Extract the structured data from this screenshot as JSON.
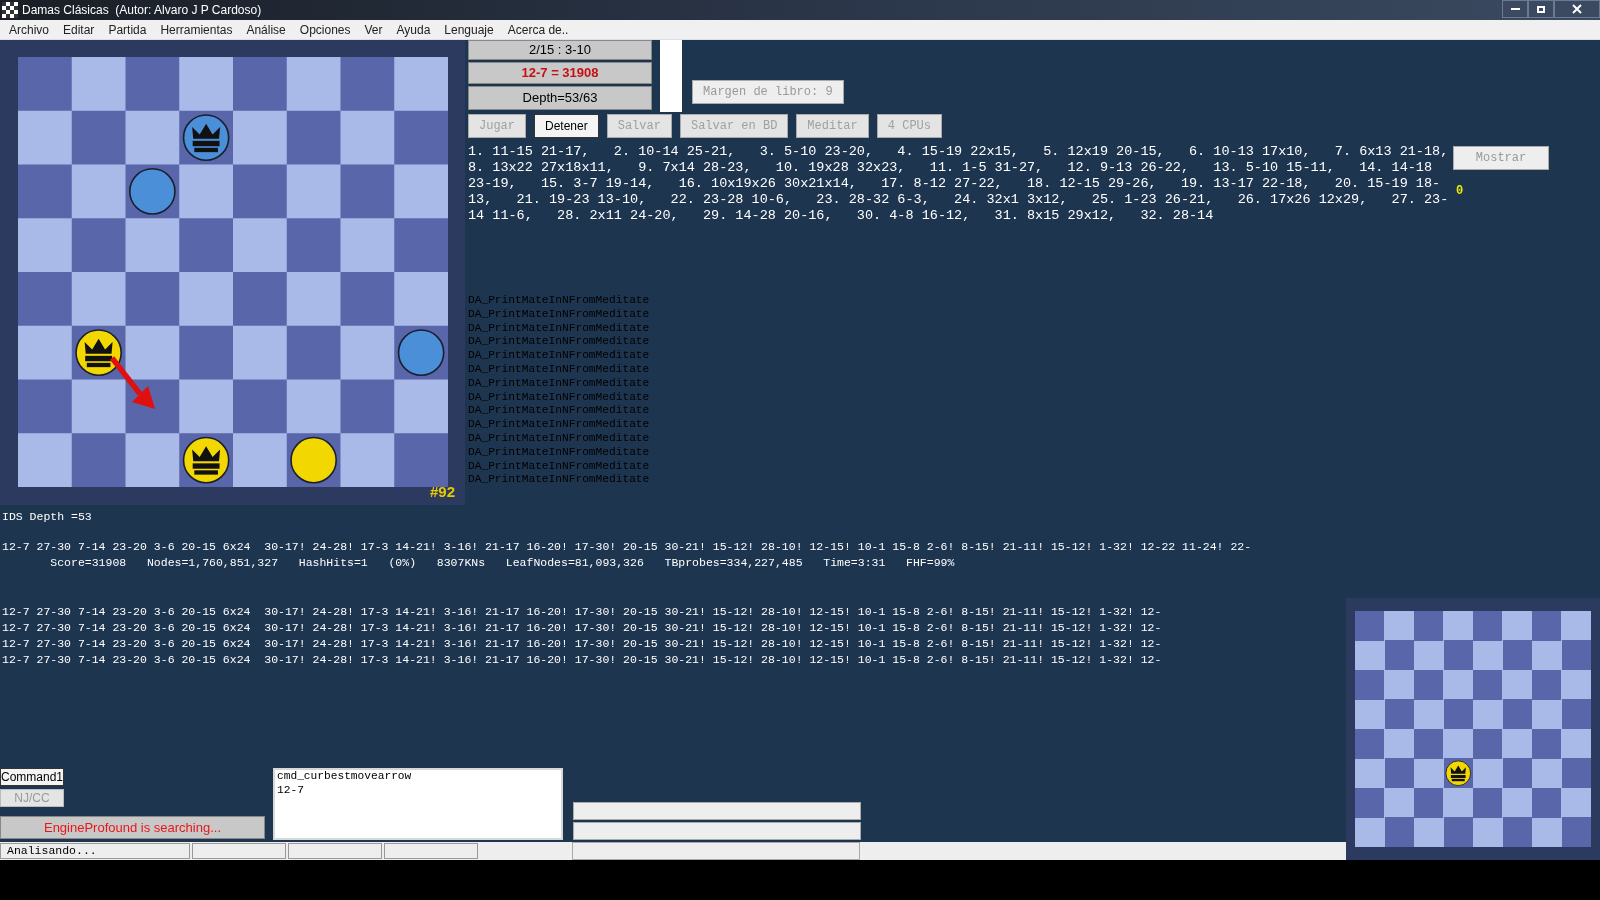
{
  "window": {
    "title": "Damas Clásicas  (Autor: Alvaro J P Cardoso)"
  },
  "menu": [
    "Archivo",
    "Editar",
    "Partida",
    "Herramientas",
    "Análise",
    "Opciones",
    "Ver",
    "Ayuda",
    "Lenguaje",
    "Acerca de.."
  ],
  "board": {
    "rows": [
      [
        {
          "kind": "empty"
        },
        {
          "kind": "empty"
        },
        {
          "kind": "empty"
        },
        {
          "kind": "empty"
        },
        {
          "kind": "empty"
        },
        {
          "kind": "empty"
        },
        {
          "kind": "empty"
        },
        {
          "kind": "empty"
        }
      ],
      [
        {
          "kind": "empty"
        },
        {
          "kind": "empty"
        },
        {
          "kind": "empty"
        },
        {
          "kind": "king",
          "color": "#4a8fd8"
        },
        {
          "kind": "empty"
        },
        {
          "kind": "empty"
        },
        {
          "kind": "empty"
        },
        {
          "kind": "empty"
        }
      ],
      [
        {
          "kind": "empty"
        },
        {
          "kind": "empty"
        },
        {
          "kind": "man",
          "color": "#4a8fd8"
        },
        {
          "kind": "empty"
        },
        {
          "kind": "empty"
        },
        {
          "kind": "empty"
        },
        {
          "kind": "empty"
        },
        {
          "kind": "empty"
        }
      ],
      [
        {
          "kind": "empty"
        },
        {
          "kind": "empty"
        },
        {
          "kind": "empty"
        },
        {
          "kind": "empty"
        },
        {
          "kind": "empty"
        },
        {
          "kind": "empty"
        },
        {
          "kind": "empty"
        },
        {
          "kind": "empty"
        }
      ],
      [
        {
          "kind": "empty"
        },
        {
          "kind": "empty"
        },
        {
          "kind": "empty"
        },
        {
          "kind": "empty"
        },
        {
          "kind": "empty"
        },
        {
          "kind": "empty"
        },
        {
          "kind": "empty"
        },
        {
          "kind": "empty"
        }
      ],
      [
        {
          "kind": "empty"
        },
        {
          "kind": "king",
          "color": "#f2d800",
          "arrow": true
        },
        {
          "kind": "empty"
        },
        {
          "kind": "empty"
        },
        {
          "kind": "empty"
        },
        {
          "kind": "empty"
        },
        {
          "kind": "empty"
        },
        {
          "kind": "man",
          "color": "#4a8fd8"
        }
      ],
      [
        {
          "kind": "empty"
        },
        {
          "kind": "empty"
        },
        {
          "kind": "empty"
        },
        {
          "kind": "empty"
        },
        {
          "kind": "empty"
        },
        {
          "kind": "empty"
        },
        {
          "kind": "empty"
        },
        {
          "kind": "empty"
        }
      ],
      [
        {
          "kind": "empty"
        },
        {
          "kind": "empty"
        },
        {
          "kind": "empty"
        },
        {
          "kind": "king",
          "color": "#f2d800"
        },
        {
          "kind": "empty"
        },
        {
          "kind": "man",
          "color": "#f2d800"
        },
        {
          "kind": "empty"
        },
        {
          "kind": "empty"
        }
      ]
    ],
    "position_number": "#92"
  },
  "info": {
    "move": "2/15 : 3-10",
    "best": "12-7 = 31908",
    "depth": "Depth=53/63"
  },
  "book_margin": "Margen de libro: 9",
  "buttons": [
    {
      "label": "Jugar",
      "disabled": true
    },
    {
      "label": "Detener",
      "disabled": false
    },
    {
      "label": "Salvar",
      "disabled": true
    },
    {
      "label": "Salvar en BD",
      "disabled": true
    },
    {
      "label": "Meditar",
      "disabled": true
    },
    {
      "label": "4 CPUs",
      "disabled": true
    }
  ],
  "moves": [
    "1. 11-15 21-17,   2. 10-14 25-21,   3. 5-10 23-20,   4. 15-19 22x15,   5. 12x19 20-15,   6. 10-13 17x10,   7. 6x13 21-18,",
    "8. 13x22 27x18x11,   9. 7x14 28-23,   10. 19x28 32x23,   11. 1-5 31-27,   12. 9-13 26-22,   13. 5-10 15-11,   14. 14-18",
    "23-19,   15. 3-7 19-14,   16. 10x19x26 30x21x14,   17. 8-12 27-22,   18. 12-15 29-26,   19. 13-17 22-18,   20. 15-19 18-",
    "13,   21. 19-23 13-10,   22. 23-28 10-6,   23. 28-32 6-3,   24. 32x1 3x12,   25. 1-23 26-21,   26. 17x26 12x29,   27. 23-",
    "14 11-6,   28. 2x11 24-20,   29. 14-28 20-16,   30. 4-8 16-12,   31. 8x15 29x12,   32. 28-14"
  ],
  "show_button": {
    "label": "Mostrar",
    "disabled": true
  },
  "counter": "0",
  "log": [
    "DA_PrintMateInNFromMeditate",
    "DA_PrintMateInNFromMeditate",
    "DA_PrintMateInNFromMeditate",
    "DA_PrintMateInNFromMeditate",
    "DA_PrintMateInNFromMeditate",
    "DA_PrintMateInNFromMeditate",
    "DA_PrintMateInNFromMeditate",
    "DA_PrintMateInNFromMeditate",
    "DA_PrintMateInNFromMeditate",
    "DA_PrintMateInNFromMeditate",
    "DA_PrintMateInNFromMeditate",
    "DA_PrintMateInNFromMeditate",
    "DA_PrintMateInNFromMeditate",
    "DA_PrintMateInNFromMeditate"
  ],
  "ids_depth": "IDS Depth =53",
  "pv": "12-7 27-30 7-14 23-20 3-6 20-15 6x24  30-17! 24-28! 17-3 14-21! 3-16! 21-17 16-20! 17-30! 20-15 30-21! 15-12! 28-10! 12-15! 10-1 15-8 2-6! 8-15! 21-11! 15-12! 1-32! 12-22 11-24! 22-",
  "stats": "       Score=31908   Nodes=1,760,851,327   HashHits=1   (0%)   8307KNs   LeafNodes=81,093,326   TBprobes=334,227,485   Time=3:31   FHF=99%",
  "pv_lines": [
    "12-7 27-30 7-14 23-20 3-6 20-15 6x24  30-17! 24-28! 17-3 14-21! 3-16! 21-17 16-20! 17-30! 20-15 30-21! 15-12! 28-10! 12-15! 10-1 15-8 2-6! 8-15! 21-11! 15-12! 1-32! 12-",
    "12-7 27-30 7-14 23-20 3-6 20-15 6x24  30-17! 24-28! 17-3 14-21! 3-16! 21-17 16-20! 17-30! 20-15 30-21! 15-12! 28-10! 12-15! 10-1 15-8 2-6! 8-15! 21-11! 15-12! 1-32! 12-",
    "12-7 27-30 7-14 23-20 3-6 20-15 6x24  30-17! 24-28! 17-3 14-21! 3-16! 21-17 16-20! 17-30! 20-15 30-21! 15-12! 28-10! 12-15! 10-1 15-8 2-6! 8-15! 21-11! 15-12! 1-32! 12-",
    "12-7 27-30 7-14 23-20 3-6 20-15 6x24  30-17! 24-28! 17-3 14-21! 3-16! 21-17 16-20! 17-30! 20-15 30-21! 15-12! 28-10! 12-15! 10-1 15-8 2-6! 8-15! 21-11! 15-12! 1-32! 12-"
  ],
  "command_buttons": [
    {
      "label": "Command1",
      "disabled": false
    },
    {
      "label": "NJ/CC",
      "disabled": true
    }
  ],
  "engine_status": "EngineProfound is searching...",
  "command_box": [
    "cmd_curbestmovearrow",
    "12-7"
  ],
  "status_bar": [
    "Analisando..."
  ],
  "mini_board": {
    "rows": [
      [
        {
          "kind": "empty"
        },
        {
          "kind": "empty"
        },
        {
          "kind": "empty"
        },
        {
          "kind": "empty"
        },
        {
          "kind": "empty"
        },
        {
          "kind": "empty"
        },
        {
          "kind": "empty"
        },
        {
          "kind": "empty"
        }
      ],
      [
        {
          "kind": "empty"
        },
        {
          "kind": "empty"
        },
        {
          "kind": "empty"
        },
        {
          "kind": "empty"
        },
        {
          "kind": "empty"
        },
        {
          "kind": "empty"
        },
        {
          "kind": "empty"
        },
        {
          "kind": "empty"
        }
      ],
      [
        {
          "kind": "empty"
        },
        {
          "kind": "empty"
        },
        {
          "kind": "empty"
        },
        {
          "kind": "empty"
        },
        {
          "kind": "empty"
        },
        {
          "kind": "empty"
        },
        {
          "kind": "empty"
        },
        {
          "kind": "empty"
        }
      ],
      [
        {
          "kind": "empty"
        },
        {
          "kind": "empty"
        },
        {
          "kind": "empty"
        },
        {
          "kind": "empty"
        },
        {
          "kind": "empty"
        },
        {
          "kind": "empty"
        },
        {
          "kind": "empty"
        },
        {
          "kind": "empty"
        }
      ],
      [
        {
          "kind": "empty"
        },
        {
          "kind": "empty"
        },
        {
          "kind": "empty"
        },
        {
          "kind": "empty"
        },
        {
          "kind": "empty"
        },
        {
          "kind": "empty"
        },
        {
          "kind": "empty"
        },
        {
          "kind": "empty"
        }
      ],
      [
        {
          "kind": "empty"
        },
        {
          "kind": "empty"
        },
        {
          "kind": "empty"
        },
        {
          "kind": "king",
          "color": "#f2d800"
        },
        {
          "kind": "empty"
        },
        {
          "kind": "empty"
        },
        {
          "kind": "empty"
        },
        {
          "kind": "empty"
        }
      ],
      [
        {
          "kind": "empty"
        },
        {
          "kind": "empty"
        },
        {
          "kind": "empty"
        },
        {
          "kind": "empty"
        },
        {
          "kind": "empty"
        },
        {
          "kind": "empty"
        },
        {
          "kind": "empty"
        },
        {
          "kind": "empty"
        }
      ],
      [
        {
          "kind": "empty"
        },
        {
          "kind": "empty"
        },
        {
          "kind": "empty"
        },
        {
          "kind": "empty"
        },
        {
          "kind": "empty"
        },
        {
          "kind": "empty"
        },
        {
          "kind": "empty"
        },
        {
          "kind": "empty"
        }
      ]
    ]
  }
}
